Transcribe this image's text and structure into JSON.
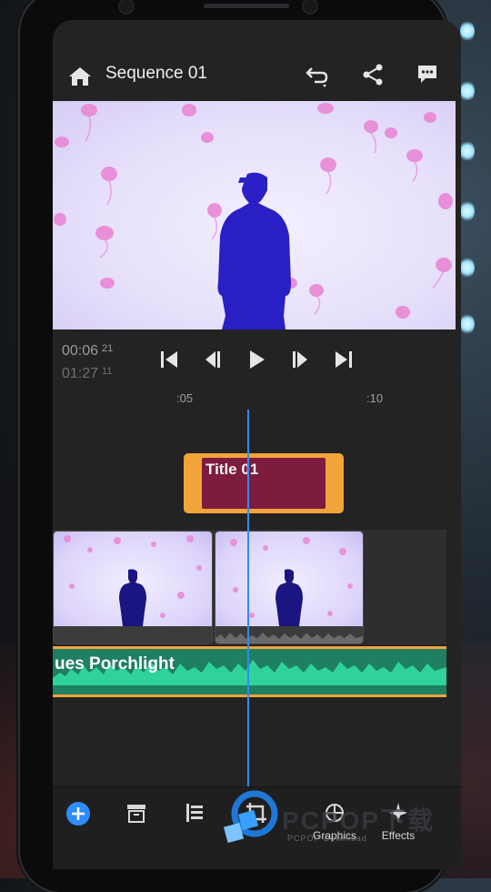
{
  "app": {
    "sequence_title": "Sequence 01",
    "icons": {
      "home": "home-icon",
      "undo": "undo-icon",
      "share": "share-icon",
      "comments": "comment-icon"
    }
  },
  "player": {
    "current_time": "00:06",
    "current_frames": "21",
    "duration_time": "01:27",
    "duration_frames": "11",
    "controls": [
      "skip-to-start-icon",
      "step-back-icon",
      "play-icon",
      "step-forward-icon",
      "skip-to-end-icon"
    ]
  },
  "timeline": {
    "ruler_marks": [
      ":05",
      ":10"
    ],
    "title_clip_label": "Title 01",
    "audio_clip_label": "ues Porchlight",
    "video_clip_count": 2
  },
  "bottom_toolbar": {
    "items": [
      {
        "icon": "add-icon",
        "label": ""
      },
      {
        "icon": "archive-icon",
        "label": ""
      },
      {
        "icon": "align-icon",
        "label": ""
      },
      {
        "icon": "crop-icon",
        "label": ""
      },
      {
        "icon": "graphics-icon",
        "label": "Graphics"
      },
      {
        "icon": "effects-icon",
        "label": "Effects"
      }
    ]
  },
  "watermark": {
    "text": "PCPOP下载",
    "sub": "PCPOP Download"
  },
  "colors": {
    "accent_blue": "#2f8cff",
    "title_clip_border": "#f2a33a",
    "title_clip_fill": "#7d1c3f",
    "audio_clip_fill": "#1e7f62",
    "panel_bg": "#232323"
  }
}
